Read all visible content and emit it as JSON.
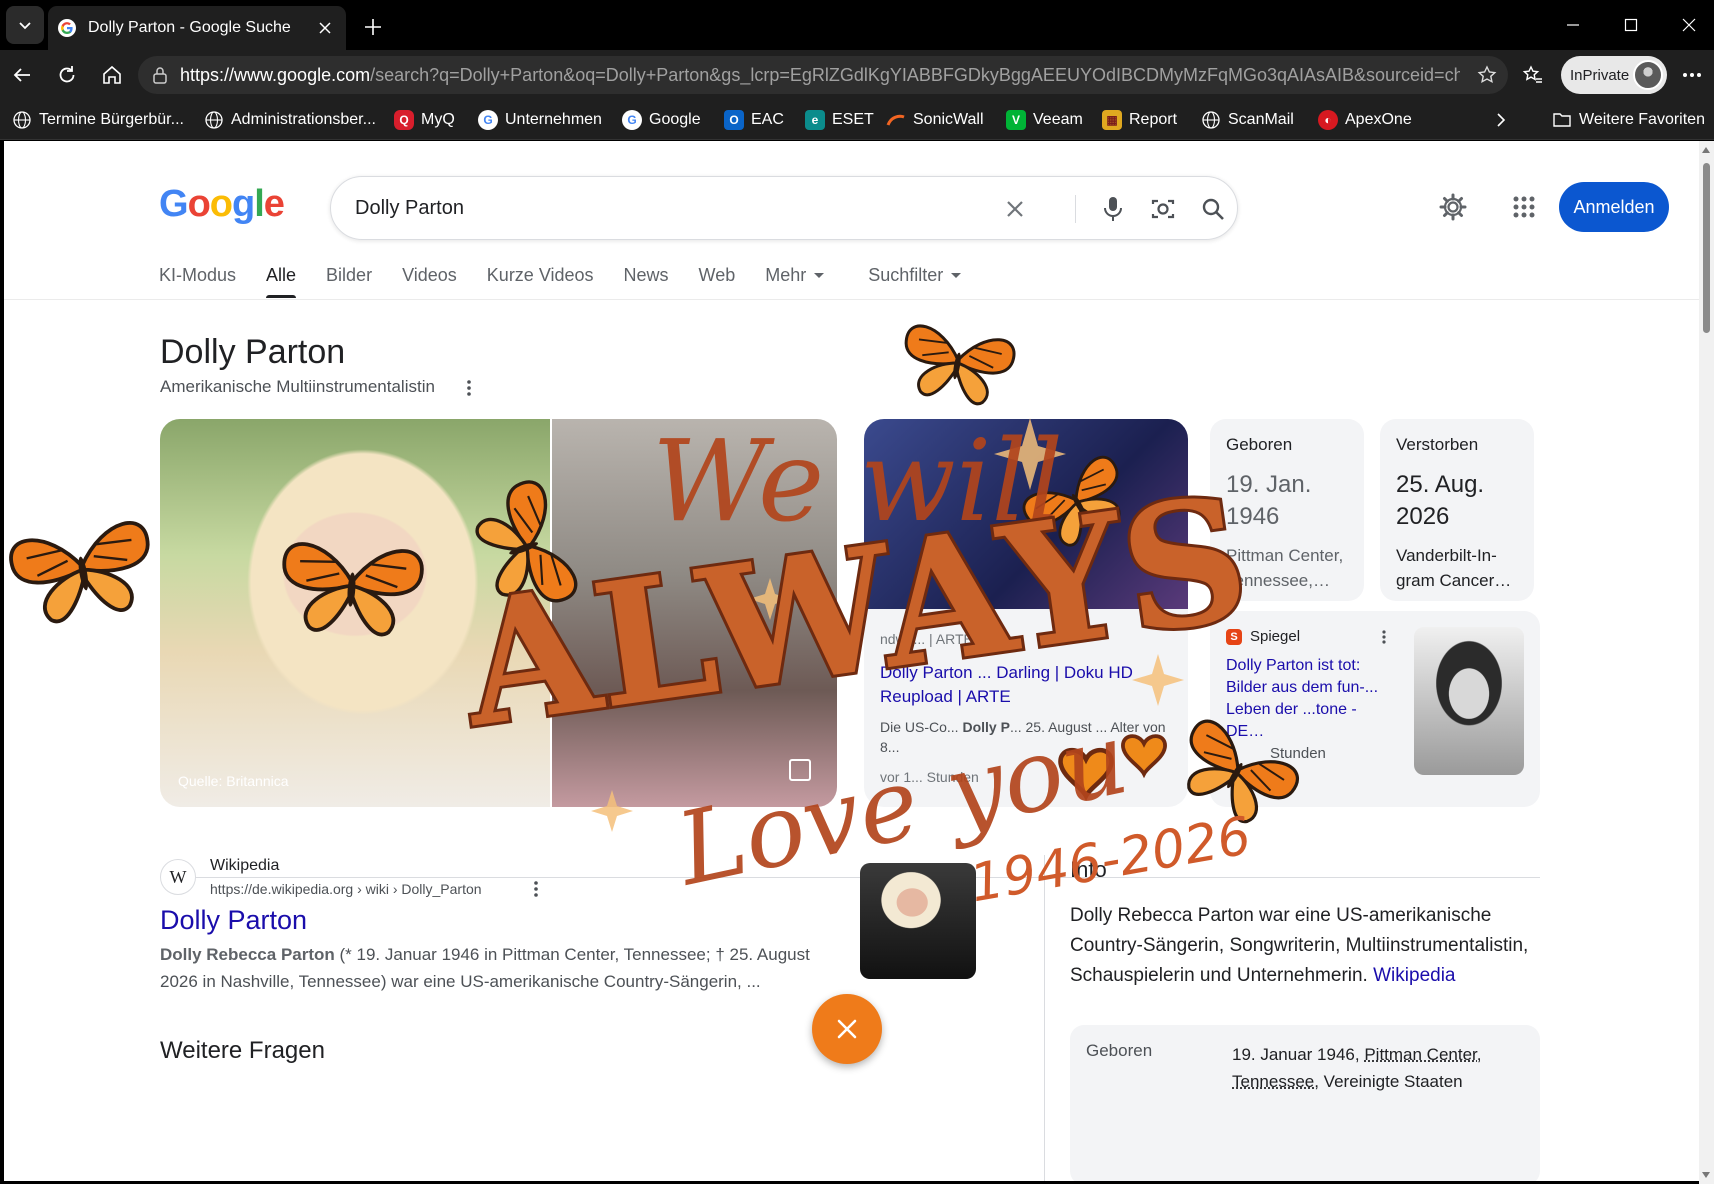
{
  "browser": {
    "tab": {
      "title": "Dolly Parton - Google Suche"
    },
    "url": {
      "host": "https://www.google.com",
      "path": "/search?q=Dolly+Parton&oq=Dolly+Parton&gs_lcrp=EgRlZGdlKgYIABBFGDkyBggAEEUYOdIBCDMyMzFqMGo3qAIAsAIB&sourceid=chrome..."
    },
    "profile_label": "InPrivate",
    "bookmarks": [
      {
        "label": "Termine Bürgerbür...",
        "icon": "globe-icon"
      },
      {
        "label": "Administrationsber...",
        "icon": "globe-icon"
      },
      {
        "label": "MyQ",
        "icon": "myq-icon"
      },
      {
        "label": "Unternehmen",
        "icon": "google-icon"
      },
      {
        "label": "Google",
        "icon": "google-icon"
      },
      {
        "label": "EAC",
        "icon": "outlook-icon"
      },
      {
        "label": "ESET",
        "icon": "eset-icon"
      },
      {
        "label": "SonicWall",
        "icon": "sonicwall-icon"
      },
      {
        "label": "Veeam",
        "icon": "veeam-icon"
      },
      {
        "label": "Report",
        "icon": "report-icon"
      },
      {
        "label": "ScanMail",
        "icon": "globe-icon"
      },
      {
        "label": "ApexOne",
        "icon": "apexone-icon"
      }
    ],
    "other_favorites": "Weitere Favoriten"
  },
  "search": {
    "logo": "Google",
    "query": "Dolly Parton",
    "signin": "Anmelden",
    "tabs": [
      {
        "label": "KI-Modus"
      },
      {
        "label": "Alle",
        "active": true
      },
      {
        "label": "Bilder"
      },
      {
        "label": "Videos"
      },
      {
        "label": "Kurze Videos"
      },
      {
        "label": "News"
      },
      {
        "label": "Web"
      },
      {
        "label": "Mehr",
        "dropdown": true
      },
      {
        "label": "Suchfilter",
        "dropdown": true
      }
    ]
  },
  "knowledge": {
    "title": "Dolly Parton",
    "subtitle": "Amerikanische Multiinstrumentalistin",
    "image_caption": "Quelle: Britannica",
    "arte": {
      "source": "ndwa... | ARTE",
      "headline": "Dolly Parton ... Darling | Doku HD Reupload | ARTE",
      "desc_pre": "Die US-Co...",
      "desc_bold": "Dolly P",
      "desc_post": "... 25. August ... Alter von 8...",
      "time": "vor 1... Stunden"
    },
    "facts": [
      {
        "label": "Geboren",
        "value": "19. Jan. 1946",
        "detail": "Pittman Center, Tennessee,…"
      },
      {
        "label": "Verstorben",
        "value": "25. Aug. 2026",
        "detail": "Vanderbilt-In-gram Cancer…"
      }
    ],
    "spiegel": {
      "source": "Spiegel",
      "headline_pre": "Dolly Parton",
      "headline_post": " ist tot: Bilder aus dem fun-... Leben der ...tone - DE…",
      "time": "Stunden"
    }
  },
  "result": {
    "site": "Wikipedia",
    "breadcrumb": "https://de.wikipedia.org › wiki › Dolly_Parton",
    "title": "Dolly Parton",
    "snippet_bold": "Dolly Rebecca Parton",
    "snippet": " (* 19. Januar 1946 in Pittman Center, Tennessee; † 25. August 2026 in Nashville, Tennessee) war eine US-amerikanische Country-Sängerin, ..."
  },
  "more_questions": "Weitere Fragen",
  "info": {
    "heading": "Info",
    "text": "Dolly Rebecca Parton war eine US-amerikanische Country-Sängerin, Songwriterin, Multiinstrumentalistin, Schauspielerin und Unternehmerin. ",
    "link": "Wikipedia",
    "born_label": "Geboren",
    "born_value_pre": "19. Januar 1946, ",
    "born_place": "Pittman Center, Tennessee",
    "born_value_post": ", Vereinigte Staaten"
  },
  "overlay": {
    "line1": "We will",
    "line2": "ALWAYS",
    "line3": "Love you",
    "years": "1946-2026",
    "colors": {
      "rust": "#b2451c",
      "orange": "#ef7b1a",
      "dark": "#6e2a10"
    }
  }
}
